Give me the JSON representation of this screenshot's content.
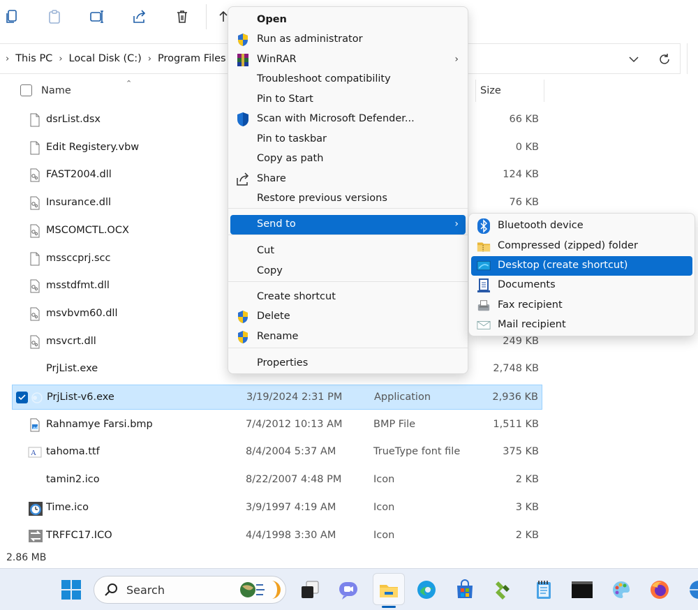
{
  "toolbar": {
    "buttons": [
      {
        "name": "copy-icon"
      },
      {
        "name": "paste-icon"
      },
      {
        "name": "rename-icon"
      },
      {
        "name": "share-icon"
      },
      {
        "name": "delete-icon"
      },
      {
        "name": "sort-up-icon"
      }
    ]
  },
  "address": {
    "crumbs": [
      "This PC",
      "Local Disk (C:)",
      "Program Files (x"
    ]
  },
  "columns": {
    "name": "Name",
    "size": "Size"
  },
  "files": [
    {
      "name": "dsrList.dsx",
      "date": "",
      "type": "",
      "size": "66 KB",
      "icon": "document-icon"
    },
    {
      "name": "Edit Registery.vbw",
      "date": "",
      "type": "",
      "size": "0 KB",
      "icon": "document-icon"
    },
    {
      "name": "FAST2004.dll",
      "date": "",
      "type": "",
      "size": "124 KB",
      "icon": "dll-icon"
    },
    {
      "name": "Insurance.dll",
      "date": "",
      "type": "",
      "size": "76 KB",
      "icon": "dll-icon"
    },
    {
      "name": "MSCOMCTL.OCX",
      "date": "",
      "type": "",
      "size": "",
      "icon": "dll-icon"
    },
    {
      "name": "mssccprj.scc",
      "date": "",
      "type": "",
      "size": "",
      "icon": "document-icon"
    },
    {
      "name": "msstdfmt.dll",
      "date": "",
      "type": "",
      "size": "",
      "icon": "dll-icon"
    },
    {
      "name": "msvbvm60.dll",
      "date": "",
      "type": "",
      "size": "",
      "icon": "dll-icon"
    },
    {
      "name": "msvcrt.dll",
      "date": "",
      "type": "",
      "size": "249 KB",
      "icon": "dll-icon"
    },
    {
      "name": "PrjList.exe",
      "date": "",
      "type": "",
      "size": "2,748 KB",
      "icon": "blank-icon"
    },
    {
      "name": "PrjList-v6.exe",
      "date": "3/19/2024 2:31 PM",
      "type": "Application",
      "size": "2,936 KB",
      "icon": "app-icon",
      "selected": true
    },
    {
      "name": "Rahnamye Farsi.bmp",
      "date": "7/4/2012 10:13 AM",
      "type": "BMP File",
      "size": "1,511 KB",
      "icon": "image-icon"
    },
    {
      "name": "tahoma.ttf",
      "date": "8/4/2004 5:37 AM",
      "type": "TrueType font file",
      "size": "375 KB",
      "icon": "font-icon"
    },
    {
      "name": "tamin2.ico",
      "date": "8/22/2007 4:48 PM",
      "type": "Icon",
      "size": "2 KB",
      "icon": "blank-icon"
    },
    {
      "name": "Time.ico",
      "date": "3/9/1997 4:19 AM",
      "type": "Icon",
      "size": "3 KB",
      "icon": "clock-icon"
    },
    {
      "name": "TRFFC17.ICO",
      "date": "4/4/1998 3:30 AM",
      "type": "Icon",
      "size": "2 KB",
      "icon": "traffic-icon"
    }
  ],
  "status": {
    "selection_size": "2.86 MB"
  },
  "taskbar": {
    "search_label": "Search",
    "apps": [
      "start-icon",
      "task-view-icon",
      "teams-icon",
      "file-explorer-icon",
      "edge-icon",
      "store-icon",
      "app-green-icon",
      "notepad-icon",
      "terminal-icon",
      "paint-icon",
      "firefox-icon",
      "globe-icon"
    ]
  },
  "context_menu": {
    "items": [
      {
        "label": "Open",
        "bold": true
      },
      {
        "label": "Run as administrator",
        "icon": "uac-shield-icon"
      },
      {
        "label": "WinRAR",
        "icon": "winrar-icon",
        "arrow": true
      },
      {
        "label": "Troubleshoot compatibility"
      },
      {
        "label": "Pin to Start"
      },
      {
        "label": "Scan with Microsoft Defender...",
        "icon": "defender-shield-icon"
      },
      {
        "label": "Pin to taskbar"
      },
      {
        "label": "Copy as path"
      },
      {
        "label": "Share",
        "icon": "share-icon"
      },
      {
        "label": "Restore previous versions"
      },
      {
        "label": "Send to",
        "arrow": true,
        "highlighted": true
      },
      {
        "label": "Cut"
      },
      {
        "label": "Copy"
      },
      {
        "label": "Create shortcut"
      },
      {
        "label": "Delete",
        "icon": "uac-shield-icon"
      },
      {
        "label": "Rename",
        "icon": "uac-shield-icon"
      },
      {
        "label": "Properties"
      }
    ]
  },
  "send_to_menu": {
    "items": [
      {
        "label": "Bluetooth device",
        "icon": "bluetooth-icon"
      },
      {
        "label": "Compressed (zipped) folder",
        "icon": "zip-folder-icon"
      },
      {
        "label": "Desktop (create shortcut)",
        "icon": "desktop-icon",
        "highlighted": true
      },
      {
        "label": "Documents",
        "icon": "documents-icon"
      },
      {
        "label": "Fax recipient",
        "icon": "fax-icon"
      },
      {
        "label": "Mail recipient",
        "icon": "mail-icon"
      }
    ]
  },
  "colors": {
    "accent": "#0a6ecf",
    "selection_bg": "#cce8ff",
    "taskbar_bg": "#e8eef8"
  }
}
